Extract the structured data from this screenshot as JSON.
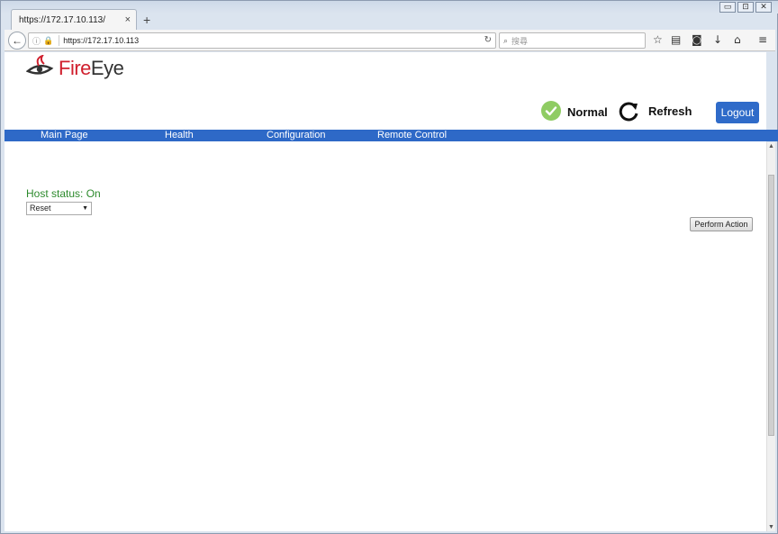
{
  "browser": {
    "tab_title": "https://172.17.10.113/",
    "tab_close": "×",
    "new_tab": "+",
    "url": "https://172.17.10.113",
    "search_placeholder": "搜尋",
    "window_controls": [
      "▭",
      "⊡",
      "✕"
    ]
  },
  "header": {
    "logo_text_fire": "Fire",
    "logo_text_eye": "Eye",
    "status_label": "Normal",
    "refresh_label": "Refresh",
    "logout_label": "Logout"
  },
  "menu": {
    "items": [
      {
        "label": "Main Page"
      },
      {
        "label": "Health"
      },
      {
        "label": "Configuration"
      },
      {
        "label": "Remote Control"
      }
    ]
  },
  "content": {
    "host_status": "Host status: On",
    "action_select_value": "Reset",
    "perform_label": "Perform Action"
  },
  "colors": {
    "menu_bar": "#2e69c7",
    "logout_button": "#2f6bc9",
    "status_ok": "#8fcc63",
    "host_status_text": "#2c8a2c",
    "brand_red": "#d0202e"
  }
}
